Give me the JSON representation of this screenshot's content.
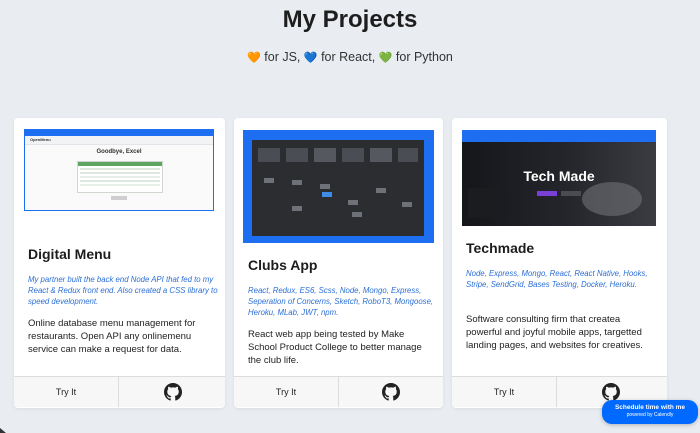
{
  "header": {
    "title": "My Projects",
    "subtitle_parts": [
      {
        "heart": "🧡",
        "text": " for JS, "
      },
      {
        "heart": "💙",
        "text": " for React, "
      },
      {
        "heart": "💚",
        "text": " for Python"
      }
    ],
    "heart_colors": [
      "#f08c2a",
      "#2d7fe0",
      "#3cb64a"
    ]
  },
  "cards": [
    {
      "title": "Digital Menu",
      "tech": "My partner built the back end Node API that fed to my React & Redux front end. Also created a CSS library to speed development.",
      "description": "Online database menu management for restaurants. Open API any onlinemenu service can make a request for data.",
      "try_label": "Try It",
      "screenshot_title": "Goodbye, Excel",
      "screenshot_logo": "OpenMenu"
    },
    {
      "title": "Clubs App",
      "tech": "React, Redux, ES6, Scss, Node, Mongo, Express, Seperation of Concerns, Sketch, RoboT3, Mongoose, Heroku, MLab, JWT, npm.",
      "description": "React web app being tested by Make School Product College to better manage the club life.",
      "try_label": "Try It"
    },
    {
      "title": "Techmade",
      "tech": "Node, Express, Mongo, React, React Native, Hooks, Stripe, SendGrid, Bases Testing, Docker, Heroku.",
      "description": "Software consulting firm that createa powerful and joyful mobile apps, targetted landing pages, and websites for creatives.",
      "try_label": "Try It",
      "screenshot_title": "Tech Made"
    }
  ],
  "calendly": {
    "line1": "Schedule time with me",
    "line2": "powered by Calendly",
    "color": "#0069ff"
  },
  "colors": {
    "accent": "#1d6ef0",
    "tech_text": "#2b6fd6",
    "background": "#e9edf1"
  },
  "icons": {
    "github": "github-icon"
  }
}
